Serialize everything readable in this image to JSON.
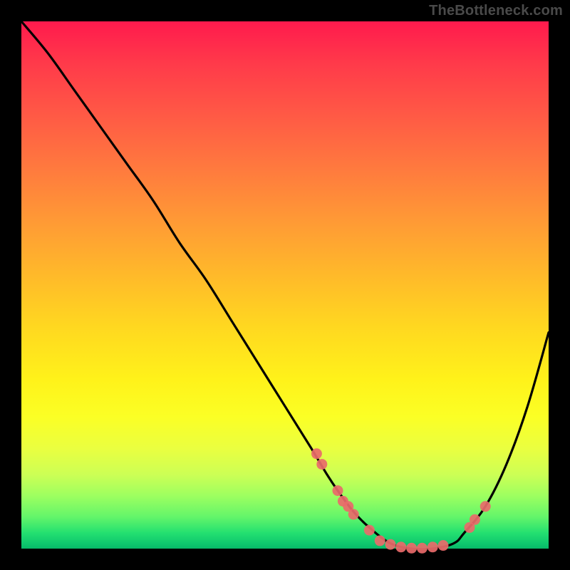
{
  "watermark": "TheBottleneck.com",
  "chart_data": {
    "type": "line",
    "title": "",
    "xlabel": "",
    "ylabel": "",
    "xlim": [
      0,
      100
    ],
    "ylim": [
      0,
      100
    ],
    "series": [
      {
        "name": "bottleneck-curve",
        "x": [
          0,
          5,
          10,
          15,
          20,
          25,
          30,
          35,
          40,
          45,
          50,
          55,
          58,
          60,
          63,
          66,
          70,
          74,
          78,
          82,
          84,
          88,
          92,
          96,
          100
        ],
        "y": [
          100,
          94,
          87,
          80,
          73,
          66,
          58,
          51,
          43,
          35,
          27,
          19,
          14,
          11,
          7,
          4,
          1,
          0,
          0,
          1,
          3,
          8,
          16,
          27,
          41
        ]
      }
    ],
    "markers": [
      {
        "x": 56,
        "y": 18
      },
      {
        "x": 57,
        "y": 16
      },
      {
        "x": 60,
        "y": 11
      },
      {
        "x": 61,
        "y": 9
      },
      {
        "x": 62,
        "y": 8
      },
      {
        "x": 63,
        "y": 6.5
      },
      {
        "x": 66,
        "y": 3.5
      },
      {
        "x": 68,
        "y": 1.5
      },
      {
        "x": 70,
        "y": 0.8
      },
      {
        "x": 72,
        "y": 0.3
      },
      {
        "x": 74,
        "y": 0.1
      },
      {
        "x": 76,
        "y": 0.1
      },
      {
        "x": 78,
        "y": 0.3
      },
      {
        "x": 80,
        "y": 0.6
      },
      {
        "x": 85,
        "y": 4
      },
      {
        "x": 86,
        "y": 5.5
      },
      {
        "x": 88,
        "y": 8
      }
    ],
    "marker_color": "#e96a6a",
    "curve_color": "#000000"
  }
}
